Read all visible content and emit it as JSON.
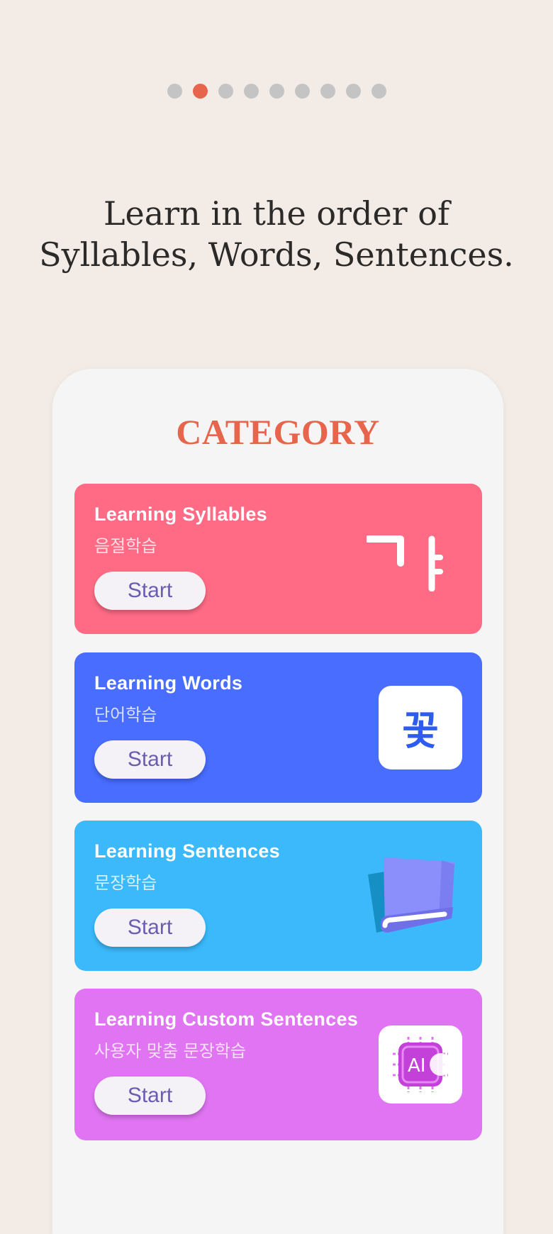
{
  "pager": {
    "total": 9,
    "active_index": 1
  },
  "headline": {
    "line1": "Learn in the order of",
    "line2": "Syllables, Words, Sentences."
  },
  "category": {
    "title": "CATEGORY",
    "cards": [
      {
        "title": "Learning Syllables",
        "subtitle": "음절학습",
        "button": "Start",
        "color": "#ff6b85",
        "icon": "syllable-ga-icon",
        "icon_text": "ㄱㅑ"
      },
      {
        "title": "Learning Words",
        "subtitle": "단어학습",
        "button": "Start",
        "color": "#486dff",
        "icon": "word-flower-icon",
        "icon_text": "꽃"
      },
      {
        "title": "Learning Sentences",
        "subtitle": "문장학습",
        "button": "Start",
        "color": "#3bb9fb",
        "icon": "books-icon"
      },
      {
        "title": "Learning Custom Sentences",
        "subtitle": "사용자 맞춤 문장학습",
        "button": "Start",
        "color": "#e074f3",
        "icon": "ai-chip-icon",
        "icon_text": "AI"
      }
    ]
  }
}
